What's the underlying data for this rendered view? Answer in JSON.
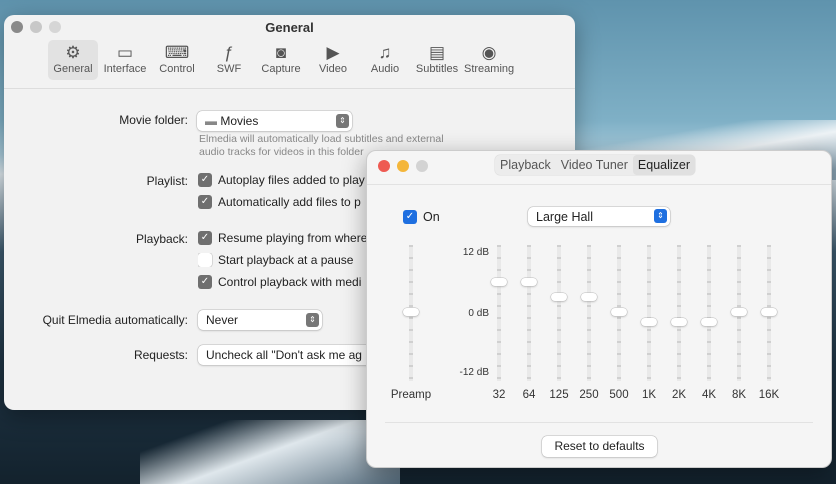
{
  "main_window": {
    "title": "General",
    "toolbar": [
      {
        "label": "General",
        "icon": "gear-icon",
        "glyph": "⚙"
      },
      {
        "label": "Interface",
        "icon": "window-icon",
        "glyph": "▭"
      },
      {
        "label": "Control",
        "icon": "keyboard-icon",
        "glyph": "⌨"
      },
      {
        "label": "SWF",
        "icon": "flash-icon",
        "glyph": "ƒ"
      },
      {
        "label": "Capture",
        "icon": "camera-icon",
        "glyph": "◙"
      },
      {
        "label": "Video",
        "icon": "play-icon",
        "glyph": "▶"
      },
      {
        "label": "Audio",
        "icon": "music-note-icon",
        "glyph": "♫"
      },
      {
        "label": "Subtitles",
        "icon": "speech-bubble-icon",
        "glyph": "▤"
      },
      {
        "label": "Streaming",
        "icon": "airplay-icon",
        "glyph": "◉"
      }
    ],
    "movie_folder": {
      "label": "Movie folder:",
      "value": "Movies",
      "hint": "Elmedia will automatically load subtitles and external audio tracks for videos in this folder"
    },
    "playlist": {
      "label": "Playlist:",
      "options": [
        {
          "label": "Autoplay files added to play",
          "checked": true
        },
        {
          "label": "Automatically add files to p",
          "checked": true
        }
      ]
    },
    "playback": {
      "label": "Playback:",
      "options": [
        {
          "label": "Resume playing from where",
          "checked": true
        },
        {
          "label": "Start playback at a pause",
          "checked": false
        },
        {
          "label": "Control playback with medi",
          "checked": true
        }
      ]
    },
    "quit": {
      "label": "Quit Elmedia automatically:",
      "value": "Never"
    },
    "requests": {
      "label": "Requests:",
      "button": "Uncheck all \"Don't ask me ag"
    }
  },
  "eq_window": {
    "tabs": [
      "Playback",
      "Video Tuner",
      "Equalizer"
    ],
    "selected_tab": "Equalizer",
    "on_label": "On",
    "on_checked": true,
    "preset": "Large Hall",
    "db_labels": [
      "12 dB",
      "0 dB",
      "-12 dB"
    ],
    "preamp": {
      "label": "Preamp",
      "value": 0
    },
    "bands": [
      {
        "label": "32",
        "value": 6
      },
      {
        "label": "64",
        "value": 6
      },
      {
        "label": "125",
        "value": 3
      },
      {
        "label": "250",
        "value": 3
      },
      {
        "label": "500",
        "value": 0
      },
      {
        "label": "1K",
        "value": -2
      },
      {
        "label": "2K",
        "value": -2
      },
      {
        "label": "4K",
        "value": -2
      },
      {
        "label": "8K",
        "value": 0
      },
      {
        "label": "16K",
        "value": 0
      }
    ],
    "range": [
      -12,
      12
    ],
    "reset_label": "Reset to defaults",
    "accent": "#1e6fe0"
  }
}
